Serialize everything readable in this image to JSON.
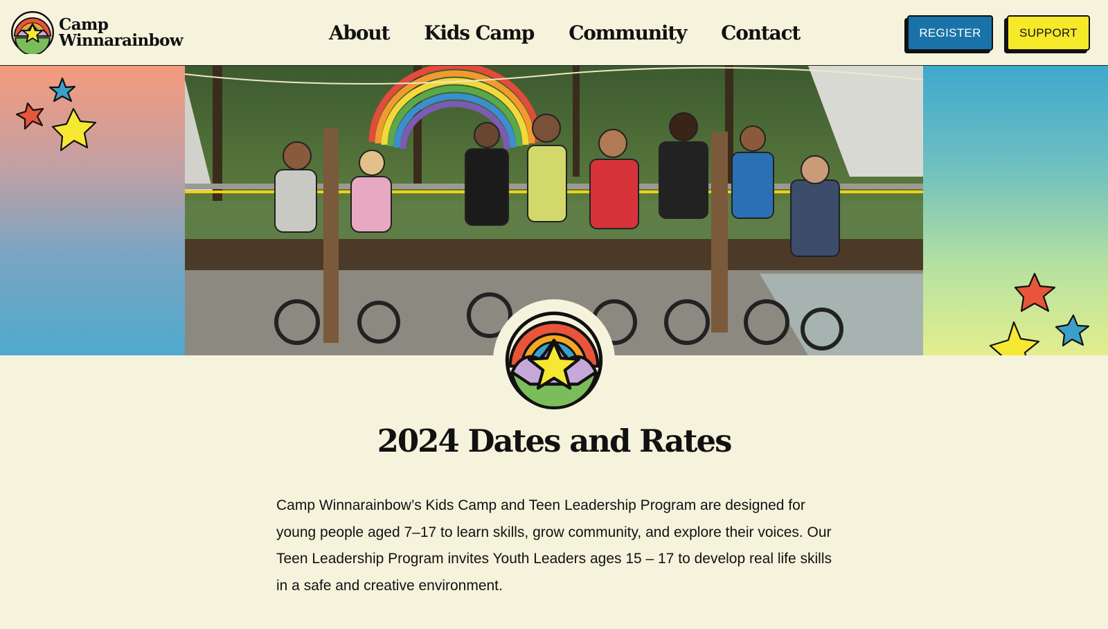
{
  "brand": {
    "line1": "Camp",
    "line2": "Winnarainbow",
    "logo_icon": "rainbow-star-logo-icon"
  },
  "nav": {
    "items": [
      {
        "label": "About"
      },
      {
        "label": "Kids Camp"
      },
      {
        "label": "Community"
      },
      {
        "label": "Contact"
      }
    ]
  },
  "actions": {
    "register_label": "REGISTER",
    "support_label": "SUPPORT"
  },
  "hero": {
    "photo_alt": "Kids sitting on unicycles in front of a rainbow arch at camp",
    "left_gradient": [
      "#f59a7c",
      "#4fa9cd"
    ],
    "right_gradient": [
      "#3ea9cc",
      "#e3ee8d"
    ]
  },
  "content": {
    "title": "2024 Dates and Rates",
    "paragraph": "Camp Winnarainbow’s Kids Camp and Teen Leadership Program are designed for young people aged 7–17 to learn skills, grow community, and explore their voices. Our Teen Leadership Program invites Youth Leaders ages 15 – 17 to develop real life skills in a safe and creative environment."
  },
  "colors": {
    "background": "#f5f3dc",
    "register": "#1a73a8",
    "support": "#f5e92a",
    "star_red": "#e8553a",
    "star_blue": "#3b9fc9",
    "star_yellow": "#f6e832"
  }
}
